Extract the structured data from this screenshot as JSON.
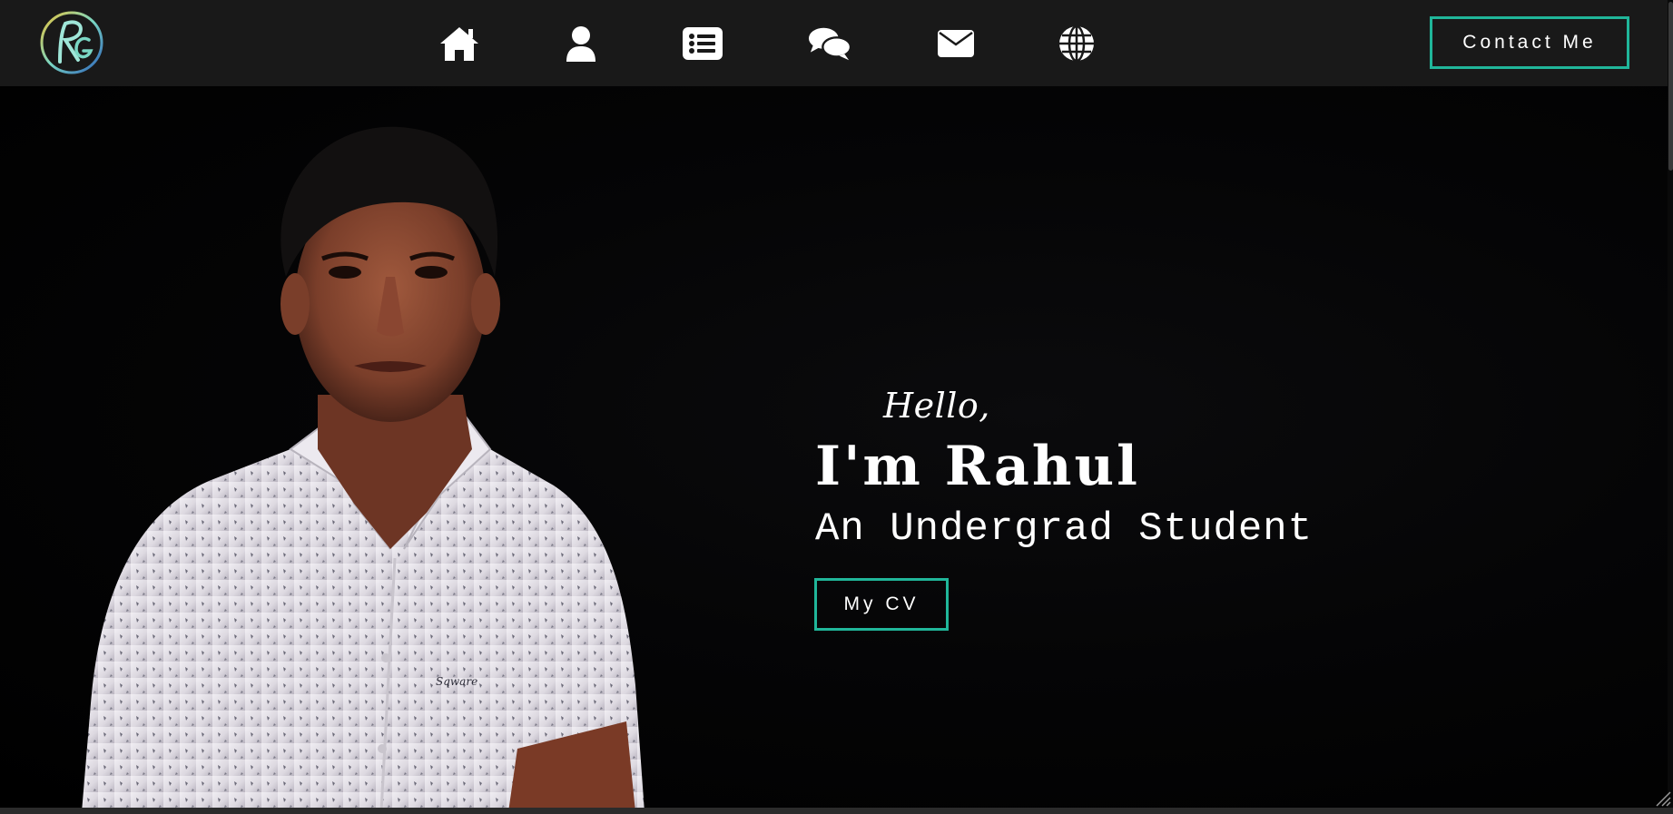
{
  "navbar": {
    "logo": {
      "icon": "rg-monogram-logo",
      "text": "RG"
    },
    "icons": [
      {
        "name": "home-icon",
        "label": "Home"
      },
      {
        "name": "user-icon",
        "label": "About"
      },
      {
        "name": "list-icon",
        "label": "Resume"
      },
      {
        "name": "comments-icon",
        "label": "Testimonials"
      },
      {
        "name": "envelope-icon",
        "label": "Contact"
      },
      {
        "name": "globe-icon",
        "label": "Social"
      }
    ],
    "contact_label": "Contact Me"
  },
  "hero": {
    "greeting": "Hello,",
    "name": "I'm Rahul",
    "role": "An Undergrad Student",
    "cv_label": "My CV",
    "portrait": "portrait-photo"
  },
  "colors": {
    "accent": "#20b69a",
    "navbar_bg": "#191919",
    "hero_bg": "#000000",
    "text": "#ffffff"
  }
}
